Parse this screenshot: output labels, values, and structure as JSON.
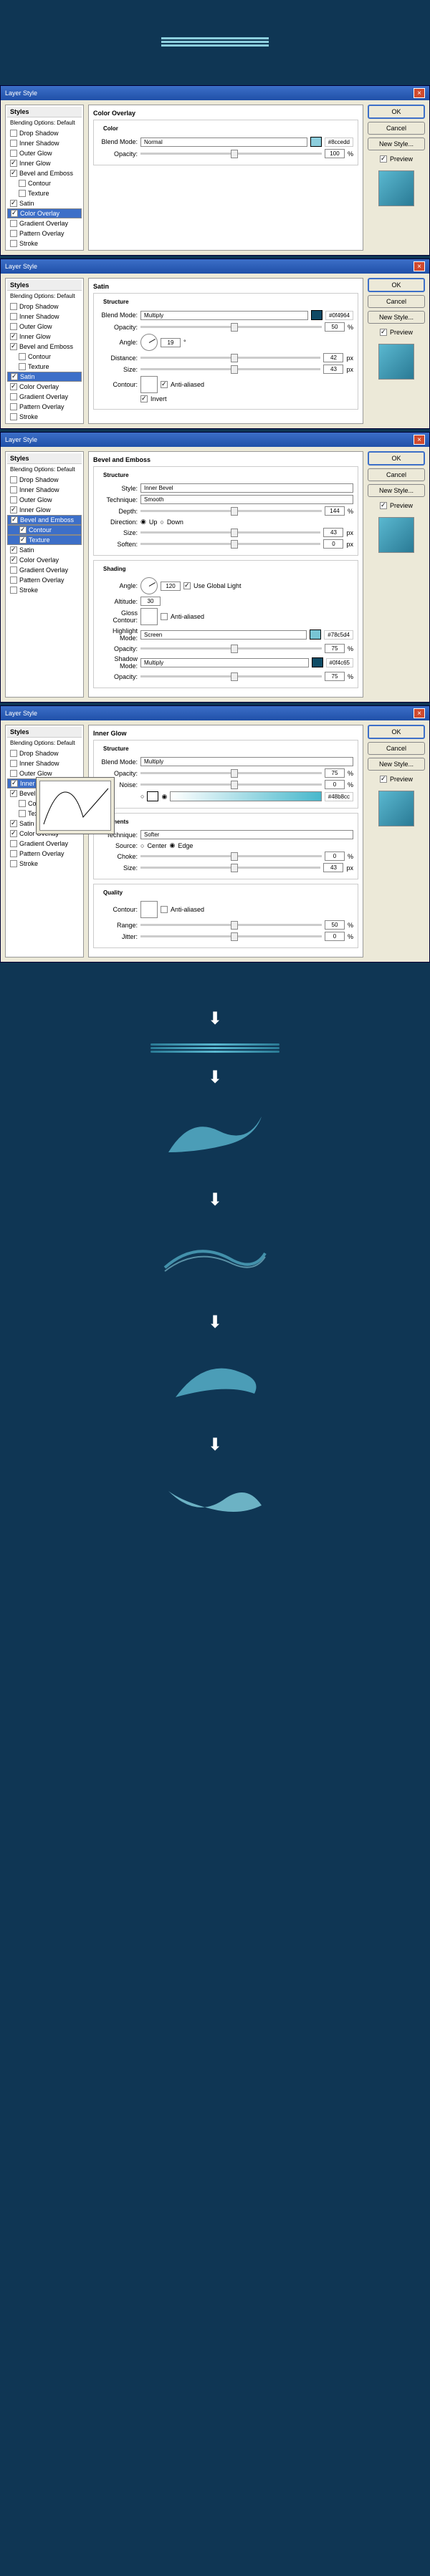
{
  "top_lines_color": "#8ccedd",
  "dialogs": [
    {
      "title": "Layer Style",
      "section": "Color Overlay",
      "styles_selected": "Color Overlay",
      "checked": [
        "Inner Glow",
        "Bevel and Emboss",
        "Color Overlay",
        "Satin"
      ],
      "hex": "#8ccedd",
      "fields": {
        "blend_mode_label": "Blend Mode:",
        "blend_mode": "Normal",
        "opacity_label": "Opacity:",
        "opacity": "100",
        "opacity_unit": "%",
        "color_legend": "Color"
      }
    },
    {
      "title": "Layer Style",
      "section": "Satin",
      "styles_selected": "Satin",
      "checked": [
        "Inner Glow",
        "Bevel and Emboss",
        "Color Overlay",
        "Satin"
      ],
      "hex": "#0f4964",
      "fields": {
        "structure_legend": "Structure",
        "blend_mode_label": "Blend Mode:",
        "blend_mode": "Multiply",
        "opacity_label": "Opacity:",
        "opacity": "50",
        "opacity_unit": "%",
        "angle_label": "Angle:",
        "angle": "19",
        "angle_unit": "°",
        "distance_label": "Distance:",
        "distance": "42",
        "distance_unit": "px",
        "size_label": "Size:",
        "size": "43",
        "size_unit": "px",
        "contour_label": "Contour:",
        "antialiased_label": "Anti-aliased",
        "invert_label": "Invert"
      }
    },
    {
      "title": "Layer Style",
      "section": "Bevel and Emboss",
      "styles_selected": "Bevel and Emboss",
      "checked": [
        "Inner Glow",
        "Bevel and Emboss",
        "Contour",
        "Texture",
        "Color Overlay",
        "Satin"
      ],
      "hex_hi": "#78c5d4",
      "hex_sh": "#0f4c65",
      "fields": {
        "structure_legend": "Structure",
        "style_label": "Style:",
        "style": "Inner Bevel",
        "technique_label": "Technique:",
        "technique": "Smooth",
        "depth_label": "Depth:",
        "depth": "144",
        "depth_unit": "%",
        "direction_label": "Direction:",
        "direction_up": "Up",
        "direction_down": "Down",
        "size_label": "Size:",
        "size": "43",
        "size_unit": "px",
        "soften_label": "Soften:",
        "soften": "0",
        "soften_unit": "px",
        "shading_legend": "Shading",
        "angle_label": "Angle:",
        "angle": "120",
        "use_global_label": "Use Global Light",
        "altitude_label": "Altitude:",
        "altitude": "30",
        "gloss_contour_label": "Gloss Contour:",
        "antialiased_label": "Anti-aliased",
        "hl_mode_label": "Highlight Mode:",
        "hl_mode": "Screen",
        "hl_opacity": "75",
        "sh_mode_label": "Shadow Mode:",
        "sh_mode": "Multiply",
        "sh_opacity": "75",
        "opacity_label": "Opacity:",
        "opacity_unit": "%"
      }
    },
    {
      "title": "Layer Style",
      "section": "Inner Glow",
      "styles_selected": "Inner Glow",
      "checked": [
        "Inner Glow",
        "Bevel and Emboss",
        "Color Overlay",
        "Satin"
      ],
      "hex": "#48b8cc",
      "fields": {
        "structure_legend": "Structure",
        "blend_mode_label": "Blend Mode:",
        "blend_mode": "Multiply",
        "opacity_label": "Opacity:",
        "opacity": "75",
        "opacity_unit": "%",
        "noise_label": "Noise:",
        "noise": "0",
        "elements_legend": "Elements",
        "technique_label": "Technique:",
        "technique": "Softer",
        "source_label": "Source:",
        "source_center": "Center",
        "source_edge": "Edge",
        "choke_label": "Choke:",
        "choke": "0",
        "size_label": "Size:",
        "size": "43",
        "size_unit": "px",
        "quality_legend": "Quality",
        "contour_label": "Contour:",
        "antialiased_label": "Anti-aliased",
        "range_label": "Range:",
        "range": "50",
        "jitter_label": "Jitter:",
        "jitter": "0"
      }
    }
  ],
  "style_items": [
    "Blending Options: Default",
    "Drop Shadow",
    "Inner Shadow",
    "Outer Glow",
    "Inner Glow",
    "Bevel and Emboss",
    "Contour",
    "Texture",
    "Satin",
    "Color Overlay",
    "Gradient Overlay",
    "Pattern Overlay",
    "Stroke"
  ],
  "buttons": {
    "ok": "OK",
    "cancel": "Cancel",
    "new_style": "New Style...",
    "preview": "Preview"
  },
  "styles_header": "Styles"
}
